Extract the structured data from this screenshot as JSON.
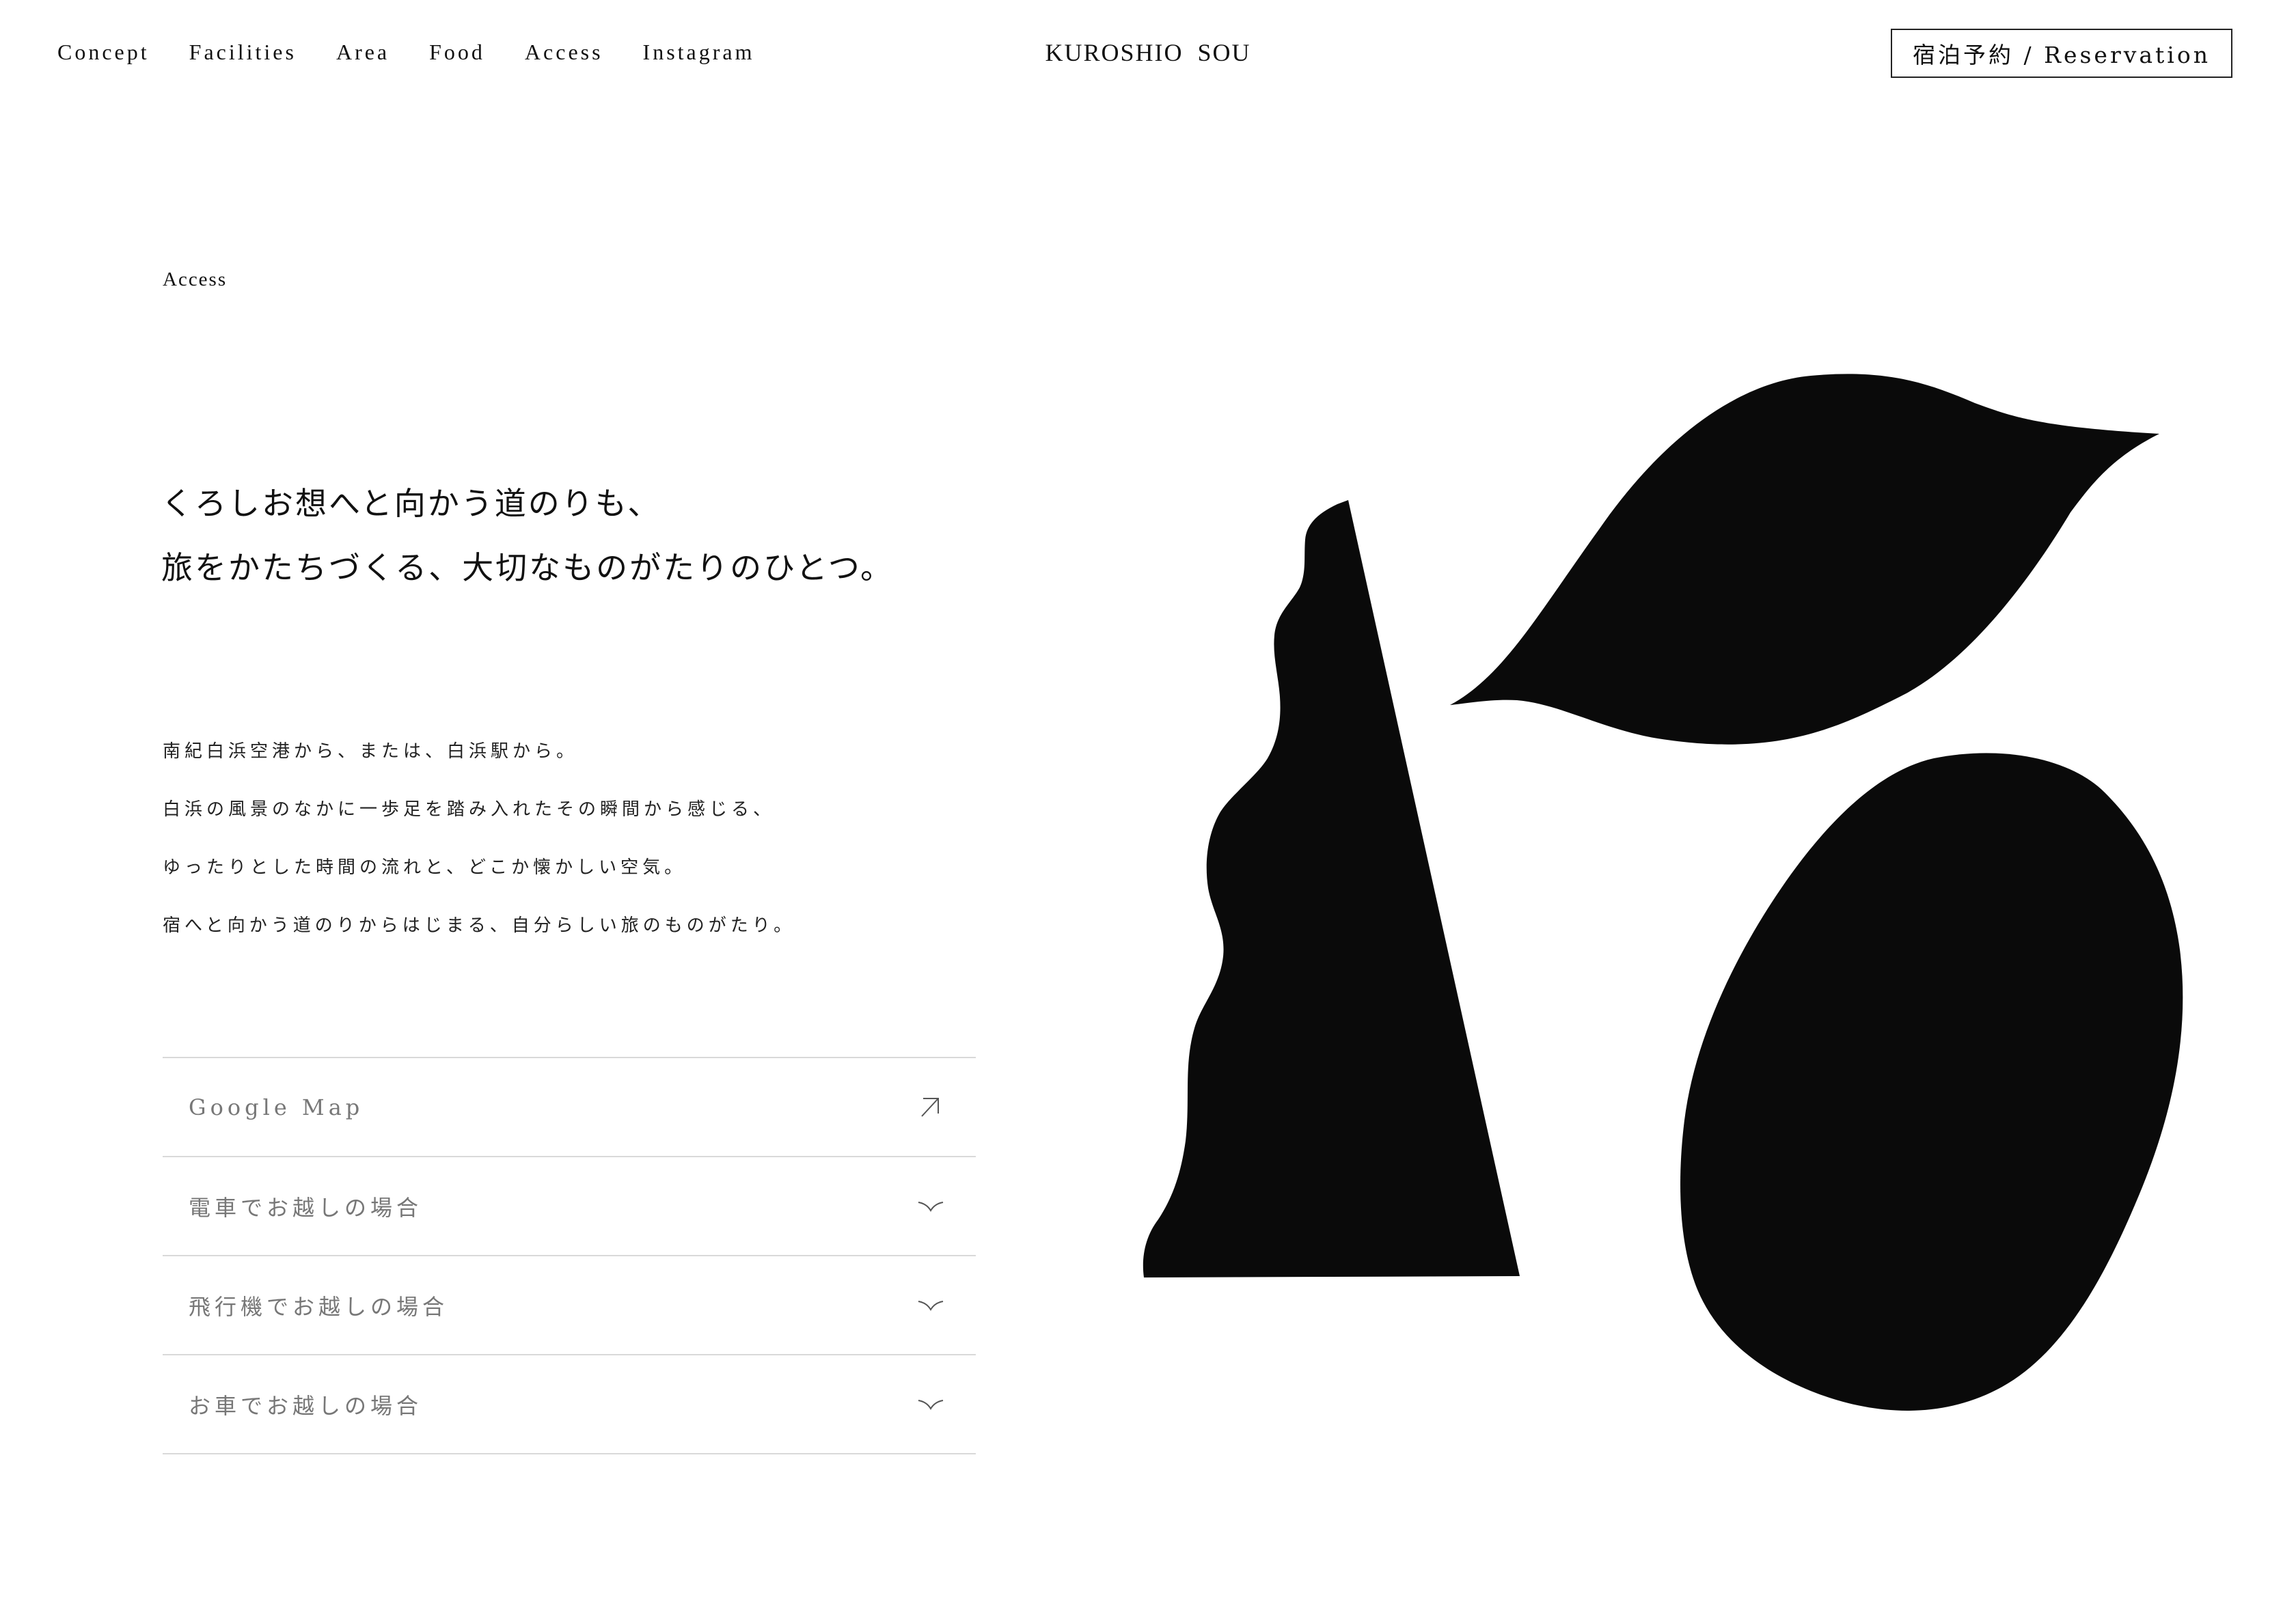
{
  "header": {
    "nav": [
      {
        "label": "Concept"
      },
      {
        "label": "Facilities"
      },
      {
        "label": "Area"
      },
      {
        "label": "Food"
      },
      {
        "label": "Access"
      },
      {
        "label": "Instagram"
      }
    ],
    "brand": "KUROSHIO SOU",
    "reserve_label": "宿泊予約 / Reservation"
  },
  "section": {
    "label": "Access",
    "headline": [
      "くろしお想へと向かう道のりも、",
      "旅をかたちづくる、大切なものがたりのひとつ。"
    ],
    "body": [
      "南紀白浜空港から、または、白浜駅から。",
      "白浜の風景のなかに一歩足を踏み入れたその瞬間から感じる、",
      "ゆったりとした時間の流れと、どこか懐かしい空気。",
      "宿へと向かう道のりからはじまる、自分らしい旅のものがたり。"
    ]
  },
  "access_items": [
    {
      "label": "Google Map",
      "icon": "external-link-arrow-icon"
    },
    {
      "label": "電車でお越しの場合",
      "icon": "chevron-down-icon"
    },
    {
      "label": "飛行機でお越しの場合",
      "icon": "chevron-down-icon"
    },
    {
      "label": "お車でお越しの場合",
      "icon": "chevron-down-icon"
    }
  ],
  "colors": {
    "ink": "#0a0a0a",
    "divider": "#d9d9d9",
    "muted_text": "#777777"
  }
}
